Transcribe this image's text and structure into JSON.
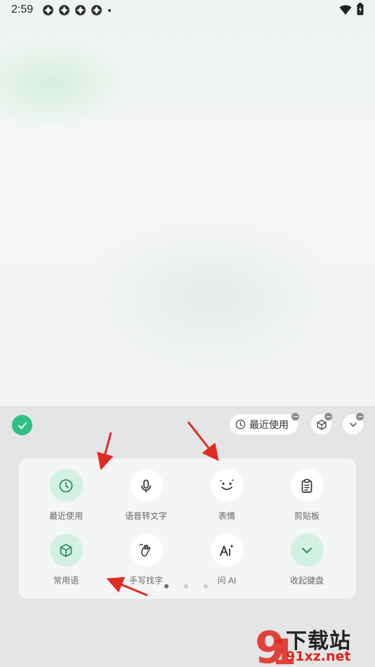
{
  "status_bar": {
    "time": "2:59",
    "notification_icons": [
      "app-notification-icon",
      "app-notification-icon",
      "app-notification-icon",
      "app-notification-icon"
    ],
    "wifi_icon": "wifi-icon",
    "battery_icon": "battery-charging-icon"
  },
  "keyboard_toolbar": {
    "confirm_icon": "check-icon",
    "recent_label": "最近使用",
    "recent_icon": "clock-icon",
    "cube_icon": "cube-icon",
    "collapse_icon": "chevron-down-icon"
  },
  "tools": [
    {
      "label": "最近使用",
      "icon": "clock-icon",
      "highlight": true
    },
    {
      "label": "语音转文字",
      "icon": "microphone-icon",
      "highlight": false
    },
    {
      "label": "表情",
      "icon": "emoji-icon",
      "highlight": false
    },
    {
      "label": "剪贴板",
      "icon": "clipboard-icon",
      "highlight": false
    },
    {
      "label": "常用语",
      "icon": "cube-icon",
      "highlight": true
    },
    {
      "label": "手写找字",
      "icon": "handwriting-icon",
      "highlight": false
    },
    {
      "label": "问 AI",
      "icon": "ai-icon",
      "highlight": false
    },
    {
      "label": "收起键盘",
      "icon": "chevron-down-icon",
      "highlight": true
    }
  ],
  "pagination": {
    "pages": 3,
    "current": 1
  },
  "watermark": {
    "title": "下载站",
    "url": "91xz.net"
  },
  "colors": {
    "accent": "#2ec185",
    "accent_light": "#d3f1e3",
    "arrow": "#e02a22"
  }
}
